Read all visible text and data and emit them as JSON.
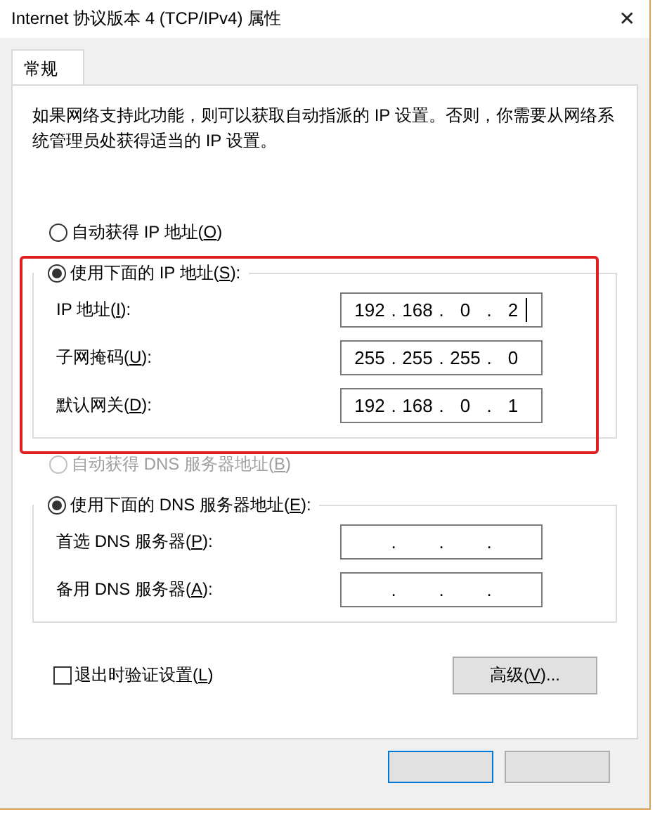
{
  "window": {
    "title": "Internet 协议版本 4 (TCP/IPv4) 属性",
    "close": "✕"
  },
  "tabs": [
    {
      "label": "常规",
      "selected": true
    }
  ],
  "intro": "如果网络支持此功能，则可以获取自动指派的 IP 设置。否则，你需要从网络系统管理员处获得适当的 IP 设置。",
  "ip_auto": {
    "label": {
      "before": "自动获得 IP 地址(",
      "key": "O",
      "after": ")"
    },
    "selected": false
  },
  "ip_manual": {
    "label": {
      "before": "使用下面的 IP 地址(",
      "key": "S",
      "after": "):"
    },
    "selected": true,
    "fields": [
      {
        "label": {
          "before": "IP 地址(",
          "key": "I",
          "after": "):"
        },
        "dot": ".",
        "octets": [
          "192",
          "168",
          "0",
          "2"
        ],
        "focused": true
      },
      {
        "label": {
          "before": "子网掩码(",
          "key": "U",
          "after": "):"
        },
        "dot": ".",
        "octets": [
          "255",
          "255",
          "255",
          "0"
        ]
      },
      {
        "label": {
          "before": "默认网关(",
          "key": "D",
          "after": "):"
        },
        "dot": ".",
        "octets": [
          "192",
          "168",
          "0",
          "1"
        ]
      }
    ]
  },
  "dns_auto": {
    "label": {
      "before": "自动获得 DNS 服务器地址(",
      "key": "B",
      "after": ")"
    },
    "selected": false,
    "disabled": true
  },
  "dns_manual": {
    "label": {
      "before": "使用下面的 DNS 服务器地址(",
      "key": "E",
      "after": "):"
    },
    "selected": true,
    "fields": [
      {
        "label": {
          "before": "首选 DNS 服务器(",
          "key": "P",
          "after": "):"
        },
        "dot": "."
      },
      {
        "label": {
          "before": "备用 DNS 服务器(",
          "key": "A",
          "after": "):"
        },
        "dot": "."
      }
    ]
  },
  "validate": {
    "label": {
      "before": "退出时验证设置(",
      "key": "L",
      "after": ")"
    },
    "checked": false
  },
  "advanced": {
    "label": {
      "before": "高级(",
      "key": "V",
      "after": ")..."
    }
  },
  "footer_buttons": [
    {
      "default": true
    },
    {
      "default": false
    }
  ]
}
